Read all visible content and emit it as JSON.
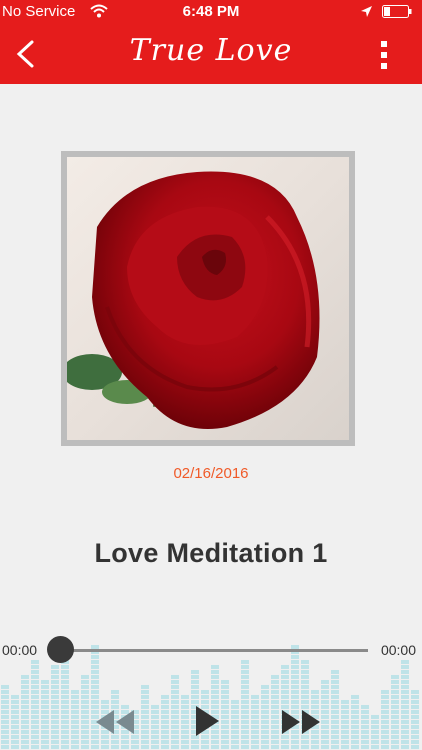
{
  "status_bar": {
    "carrier": "No Service",
    "time": "6:48 PM"
  },
  "header": {
    "title": "True Love"
  },
  "album": {
    "date": "02/16/2016",
    "track_title": "Love Meditation 1"
  },
  "player": {
    "elapsed": "00:00",
    "duration": "00:00",
    "progress": 0
  },
  "colors": {
    "accent": "#e51c1c",
    "date": "#f05a28",
    "equalizer": "#bfe3e8"
  },
  "icons": {
    "back": "chevron-left-icon",
    "more": "vertical-dots-icon",
    "rewind": "rewind-icon",
    "play": "play-icon",
    "forward": "fast-forward-icon"
  }
}
